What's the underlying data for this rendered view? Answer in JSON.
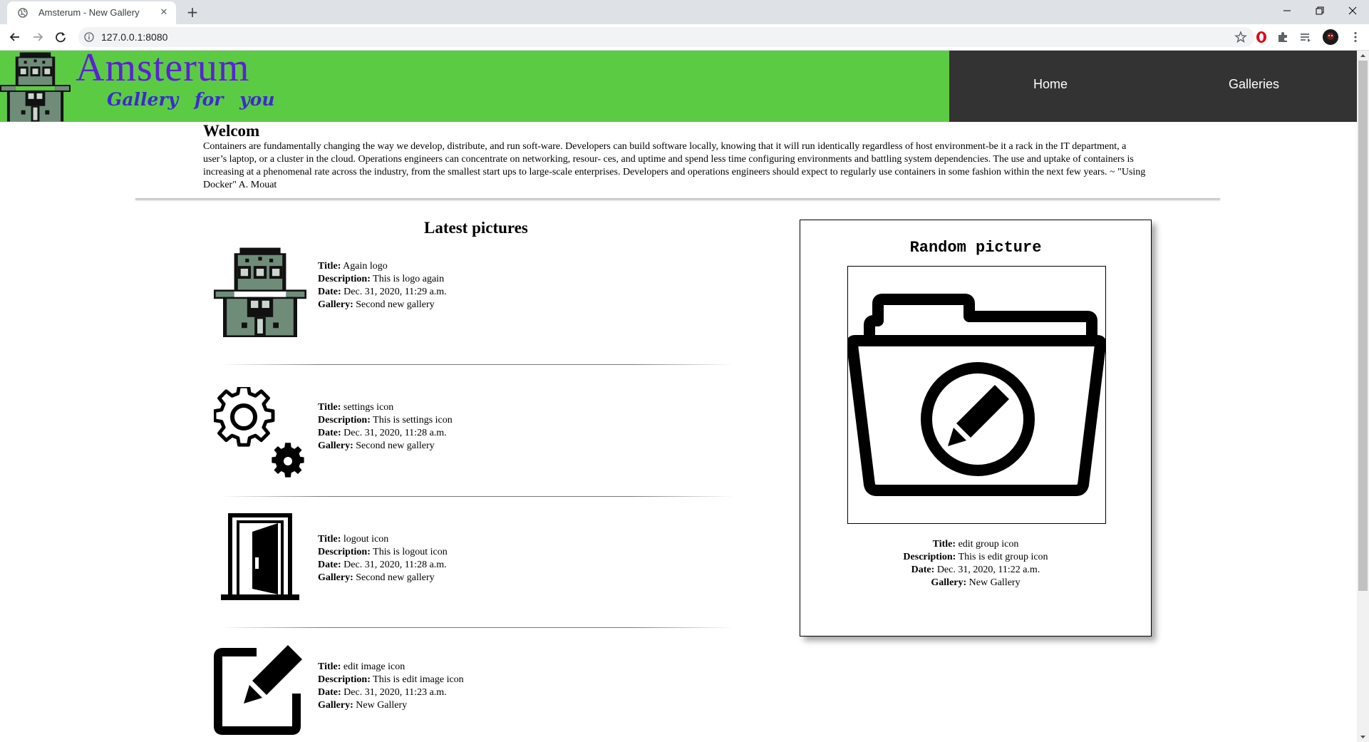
{
  "browser": {
    "tab_title": "Amsterum - New Gallery",
    "tab_close": "✕",
    "new_tab": "+",
    "url": "127.0.0.1:8080"
  },
  "header": {
    "brand": "Amsterum",
    "tagline": "Gallery for you",
    "nav": {
      "home": "Home",
      "galleries": "Galleries"
    }
  },
  "welcome": {
    "heading": "Welcom",
    "text": "Containers are fundamentally changing the way we develop, distribute, and run soft-ware. Developers can build software locally, knowing that it will run identically regardless of host environment-be it a rack in the IT department, a user’s laptop, or a cluster in the cloud. Operations engineers can concentrate on networking, resour- ces, and uptime and spend less time configuring environments and battling system dependencies. The use and uptake of containers is increasing at a phenomenal rate across the industry, from the smallest start ups to large-scale enterprises. Developers and operations engineers should expect to regularly use containers in some fashion within the next few years. ~ \"Using Docker\" A. Mouat"
  },
  "labels": {
    "title": "Title:",
    "description": "Description:",
    "date": "Date:",
    "gallery": "Gallery:"
  },
  "latest": {
    "heading": "Latest pictures",
    "items": [
      {
        "icon": "robot-logo-icon",
        "title": "Again logo",
        "description": "This is logo again",
        "date": "Dec. 31, 2020, 11:29 a.m.",
        "gallery": "Second new gallery"
      },
      {
        "icon": "settings-gears-icon",
        "title": "settings icon",
        "description": "This is settings icon",
        "date": "Dec. 31, 2020, 11:28 a.m.",
        "gallery": "Second new gallery"
      },
      {
        "icon": "logout-door-icon",
        "title": "logout icon",
        "description": "This is logout icon",
        "date": "Dec. 31, 2020, 11:28 a.m.",
        "gallery": "Second new gallery"
      },
      {
        "icon": "edit-image-icon",
        "title": "edit image icon",
        "description": "This is edit image icon",
        "date": "Dec. 31, 2020, 11:23 a.m.",
        "gallery": "New Gallery"
      }
    ]
  },
  "random": {
    "heading": "Random picture",
    "icon": "edit-group-folder-icon",
    "title": "edit group icon",
    "description": "This is edit group icon",
    "date": "Dec. 31, 2020, 11:22 a.m.",
    "gallery": "New Gallery"
  },
  "colors": {
    "header_green": "#5ccb44",
    "nav_dark": "#333333",
    "brand_purple": "#5b21d6",
    "robot_green": "#6f8c79"
  }
}
